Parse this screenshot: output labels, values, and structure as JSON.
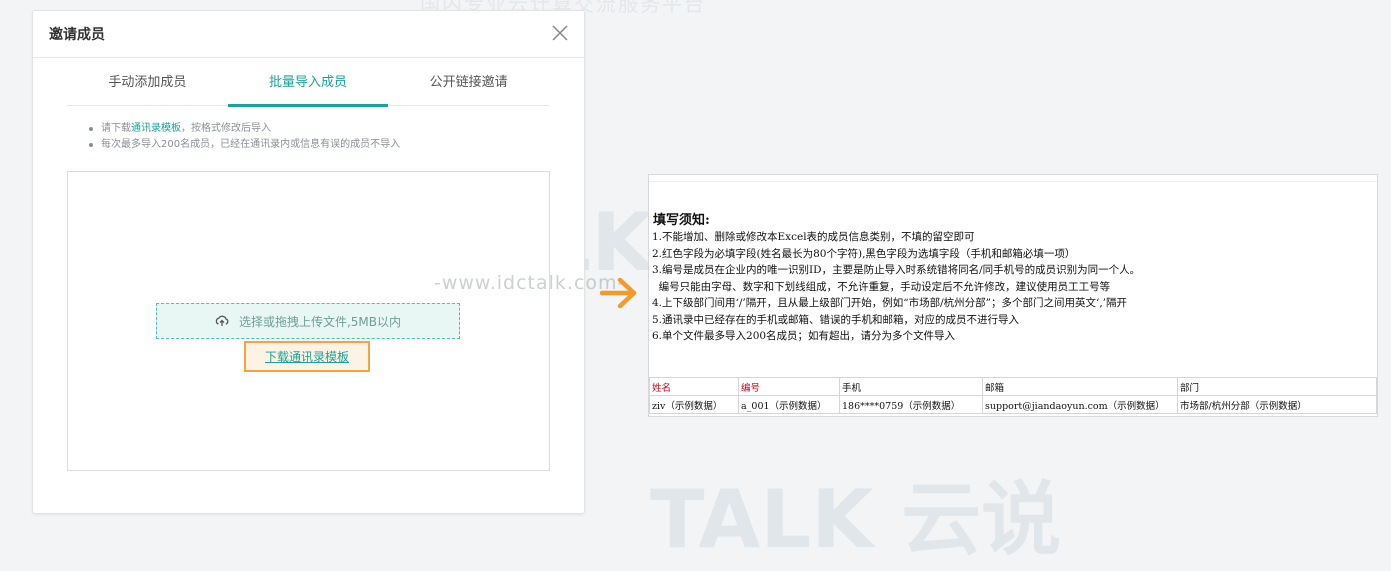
{
  "page": {
    "top_banner": "国内专业云计算交流服务平台"
  },
  "dialog": {
    "title": "邀请成员",
    "tabs": [
      {
        "label": "手动添加成员"
      },
      {
        "label": "批量导入成员"
      },
      {
        "label": "公开链接邀请"
      }
    ],
    "active_tab": 1,
    "notes": {
      "line1_prefix": "请下载",
      "line1_link": "通讯录模板",
      "line1_suffix": "，按格式修改后导入",
      "line2": "每次最多导入200名成员，已经在通讯录内或信息有误的成员不导入"
    },
    "upload_label": "选择或拖拽上传文件,5MB以内",
    "template_link": "下载通讯录模板"
  },
  "watermark": {
    "brand": "TALK 云说",
    "url": "-www.idctalk.com-"
  },
  "sheet": {
    "heading": "填写须知:",
    "rules": [
      "1.不能增加、删除或修改本Excel表的成员信息类别，不填的留空即可",
      "2.红色字段为必填字段(姓名最长为80个字符),黑色字段为选填字段（手机和邮箱必填一项）",
      "3.编号是成员在企业内的唯一识别ID，主要是防止导入时系统错将同名/同手机号的成员识别为同一个人。",
      "  编号只能由字母、数字和下划线组成，不允许重复，手动设定后不允许修改，建议使用员工工号等",
      "4.上下级部门间用‘/’隔开，且从最上级部门开始，例如“市场部/杭州分部”；多个部门之间用英文‘,’隔开",
      "5.通讯录中已经存在的手机或邮箱、错误的手机和邮箱，对应的成员不进行导入",
      "6.单个文件最多导入200名成员；如有超出，请分为多个文件导入"
    ],
    "headers": [
      "姓名",
      "编号",
      "手机",
      "邮箱",
      "部门"
    ],
    "required_columns": [
      0,
      1
    ],
    "row": [
      "ziv（示例数据）",
      "a_001（示例数据）",
      "186****0759（示例数据）",
      "support@jiandaoyun.com（示例数据）",
      "市场部/杭州分部（示例数据）"
    ]
  },
  "colors": {
    "accent": "#1aa39a",
    "highlight": "#f4a340",
    "required": "#d0021b"
  },
  "icons": {
    "close": "close-icon",
    "upload": "upload-cloud-icon",
    "arrow": "arrow-right-icon"
  }
}
